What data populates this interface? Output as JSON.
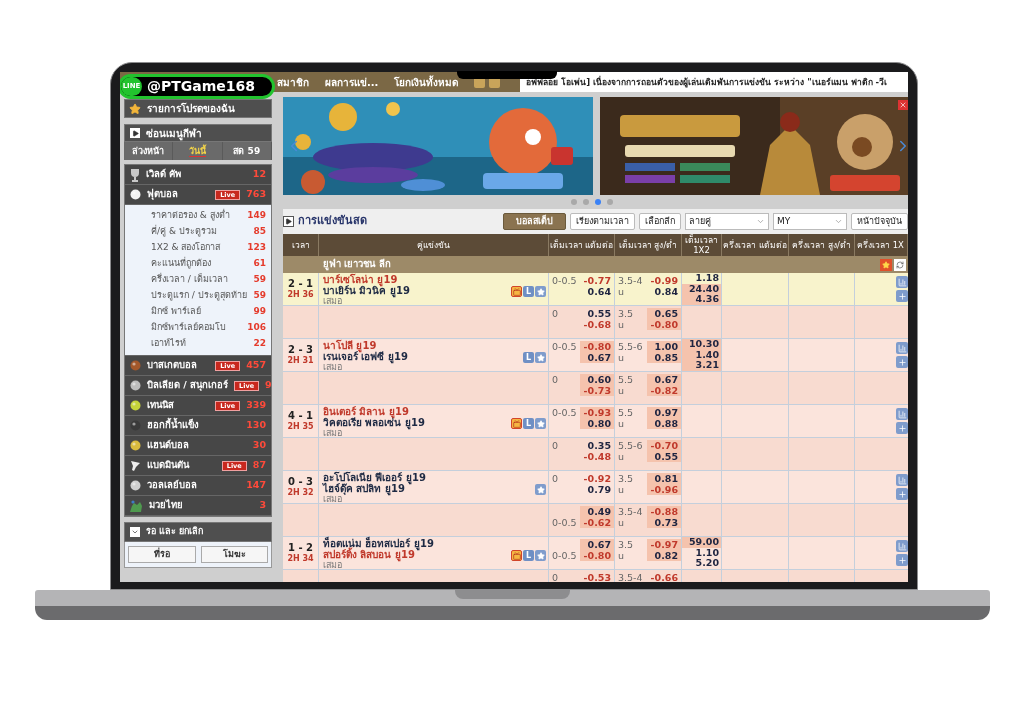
{
  "promo_badge": {
    "logo": "LINE",
    "handle": "@PTGame168"
  },
  "nav": {
    "items": [
      "สมาชิก",
      "ผลการแข่...",
      "โยกเงินทั้งหมด"
    ],
    "ticker": "อฟฟลอย โอเพ่น] เนื่องจากการถอนตัวของผู้เล่นเดิมพันการแข่งขัน ระหว่าง \"เนอร์แมน ฟาติก -วีเ"
  },
  "sidebar": {
    "favorites": "รายการโปรดของฉัน",
    "menu_toggle": "ซ่อนเมนูกีฬา",
    "tabs": [
      {
        "label": "ล่วงหน้า",
        "selected": false
      },
      {
        "label": "วันนี้",
        "selected": true
      },
      {
        "label": "สด 59",
        "selected": false
      }
    ],
    "sports": [
      {
        "name": "เวิลด์ คัพ",
        "count": "12",
        "kind": "trophy"
      },
      {
        "name": "ฟุตบอล",
        "count": "763",
        "kind": "soccer",
        "badge": "Live",
        "children": [
          {
            "name": "ราคาต่อรอง & สูงต่ำ",
            "count": "149"
          },
          {
            "name": "คี่/คู่ & ประตูรวม",
            "count": "85"
          },
          {
            "name": "1X2 & สองโอกาส",
            "count": "123"
          },
          {
            "name": "คะแนนที่ถูกต้อง",
            "count": "61"
          },
          {
            "name": "ครึ่งเวลา / เต็มเวลา",
            "count": "59"
          },
          {
            "name": "ประตูแรก / ประตูสุดท้าย",
            "count": "59"
          },
          {
            "name": "มิกซ์ พาร์เลย์",
            "count": "99"
          },
          {
            "name": "มิกซ์พาร์เลย์คอมโบ",
            "count": "106"
          },
          {
            "name": "เอาท์ไรท์",
            "count": "22"
          }
        ]
      },
      {
        "name": "บาสเกตบอล",
        "count": "457",
        "kind": "basketball",
        "badge": "Live"
      },
      {
        "name": "บิลเลียด / สนุกเกอร์",
        "count": "9",
        "kind": "billiards",
        "badge": "Live"
      },
      {
        "name": "เทนนิส",
        "count": "339",
        "kind": "tennis",
        "badge": "Live"
      },
      {
        "name": "ฮอกกี้น้ำแข็ง",
        "count": "130",
        "kind": "hockey"
      },
      {
        "name": "แฮนด์บอล",
        "count": "30",
        "kind": "handball"
      },
      {
        "name": "แบดมินตัน",
        "count": "87",
        "kind": "badminton",
        "badge": "Live"
      },
      {
        "name": "วอลเลย์บอล",
        "count": "147",
        "kind": "volleyball"
      },
      {
        "name": "มวยไทย",
        "count": "3",
        "kind": "boxing"
      }
    ],
    "pending": {
      "title": "รอ และ ยกเลิก",
      "buttons": [
        "ที่รอ",
        "โมฆะ"
      ]
    }
  },
  "carousel": {
    "dots": [
      {
        "selected": false
      },
      {
        "selected": false
      },
      {
        "selected": true
      },
      {
        "selected": false
      }
    ]
  },
  "live": {
    "title": "การแข่งขันสด",
    "controls": [
      {
        "kind": "button",
        "label": "บอลสเต็ป",
        "selected": true
      },
      {
        "kind": "button",
        "label": "เรียงตามเวลา",
        "selected": false
      },
      {
        "kind": "button",
        "label": "เลือกลีก",
        "selected": false
      },
      {
        "kind": "select",
        "label": "ลายคู่"
      },
      {
        "kind": "select",
        "label": "MY"
      },
      {
        "kind": "button",
        "label": "หน้าปัจจุบัน",
        "selected": false
      }
    ],
    "columns": [
      "เวลา",
      "คู่แข่งขัน",
      "เต็มเวลา แต้มต่อ",
      "เต็มเวลา สูง/ต่ำ",
      "เต็มเวลา 1X2",
      "ครึ่งเวลา แต้มต่อ",
      "ครึ่งเวลา สูง/ต่ำ",
      "ครึ่งเวลา 1X"
    ],
    "league": "ยูฟ่า เยาวชน ลีก",
    "matches": [
      {
        "score": "2 - 1",
        "time": "2H 36",
        "selected": true,
        "teams": [
          {
            "name": "บาร์เซโลน่า ยู19",
            "favorite": true
          },
          {
            "name": "บาเยิร์น มิวนิค ยู19",
            "favorite": false
          }
        ],
        "draw": "เสมอ",
        "icons": [
          {
            "kind": "tv"
          },
          {
            "kind": "letter",
            "text": "L"
          },
          {
            "kind": "star"
          }
        ],
        "lines": [
          {
            "handicap": {
              "line": "0-0.5",
              "away_gives": false,
              "highlight": false,
              "odds": [
                {
                  "text": "-0.77",
                  "negative": true
                },
                {
                  "text": "0.64",
                  "negative": false
                }
              ]
            },
            "over_under": {
              "line": "3.5-4",
              "under_label": "u",
              "highlight": false,
              "odds": [
                {
                  "text": "-0.99",
                  "negative": true
                },
                {
                  "text": "0.84",
                  "negative": false
                }
              ]
            },
            "result": [
              {
                "text": "1.18",
                "highlight": false
              },
              {
                "text": "24.40",
                "highlight": true
              },
              {
                "text": "4.36",
                "highlight": true
              }
            ]
          },
          {
            "handicap": {
              "line": "0",
              "away_gives": false,
              "highlight": false,
              "odds": [
                {
                  "text": "0.55",
                  "negative": false
                },
                {
                  "text": "-0.68",
                  "negative": true
                }
              ]
            },
            "over_under": {
              "line": "3.5",
              "under_label": "u",
              "highlight": true,
              "odds": [
                {
                  "text": "0.65",
                  "negative": false
                },
                {
                  "text": "-0.80",
                  "negative": true
                }
              ]
            }
          }
        ]
      },
      {
        "score": "2 - 3",
        "time": "2H 31",
        "selected": false,
        "teams": [
          {
            "name": "นาโปลี ยู19",
            "favorite": true
          },
          {
            "name": "เรนเจอร์ เอฟซี ยู19",
            "favorite": false
          }
        ],
        "draw": "เสมอ",
        "icons": [
          {
            "kind": "letter",
            "text": "L"
          },
          {
            "kind": "star"
          }
        ],
        "lines": [
          {
            "handicap": {
              "line": "0-0.5",
              "away_gives": false,
              "highlight": true,
              "odds": [
                {
                  "text": "-0.80",
                  "negative": true
                },
                {
                  "text": "0.67",
                  "negative": false
                }
              ]
            },
            "over_under": {
              "line": "5.5-6",
              "under_label": "u",
              "highlight": true,
              "odds": [
                {
                  "text": "1.00",
                  "negative": false
                },
                {
                  "text": "0.85",
                  "negative": false
                }
              ]
            },
            "result": [
              {
                "text": "10.30",
                "highlight": true
              },
              {
                "text": "1.40",
                "highlight": true
              },
              {
                "text": "3.21",
                "highlight": true
              }
            ]
          },
          {
            "handicap": {
              "line": "0",
              "away_gives": false,
              "highlight": true,
              "odds": [
                {
                  "text": "0.60",
                  "negative": false
                },
                {
                  "text": "-0.73",
                  "negative": true
                }
              ]
            },
            "over_under": {
              "line": "5.5",
              "under_label": "u",
              "highlight": true,
              "odds": [
                {
                  "text": "0.67",
                  "negative": false
                },
                {
                  "text": "-0.82",
                  "negative": true
                }
              ]
            }
          }
        ]
      },
      {
        "score": "4 - 1",
        "time": "2H 35",
        "selected": false,
        "teams": [
          {
            "name": "อินเตอร์ มิลาน ยู19",
            "favorite": true
          },
          {
            "name": "วิคตอเรีย พลอเซ่น ยู19",
            "favorite": false
          }
        ],
        "draw": "เสมอ",
        "icons": [
          {
            "kind": "tv"
          },
          {
            "kind": "letter",
            "text": "L"
          },
          {
            "kind": "star"
          }
        ],
        "lines": [
          {
            "handicap": {
              "line": "0-0.5",
              "away_gives": false,
              "highlight": true,
              "odds": [
                {
                  "text": "-0.93",
                  "negative": true
                },
                {
                  "text": "0.80",
                  "negative": false
                }
              ]
            },
            "over_under": {
              "line": "5.5",
              "under_label": "u",
              "highlight": true,
              "odds": [
                {
                  "text": "0.97",
                  "negative": false
                },
                {
                  "text": "0.88",
                  "negative": false
                }
              ]
            }
          },
          {
            "handicap": {
              "line": "0",
              "away_gives": false,
              "highlight": false,
              "odds": [
                {
                  "text": "0.35",
                  "negative": false
                },
                {
                  "text": "-0.48",
                  "negative": true
                }
              ]
            },
            "over_under": {
              "line": "5.5-6",
              "under_label": "u",
              "highlight": true,
              "odds": [
                {
                  "text": "-0.70",
                  "negative": true
                },
                {
                  "text": "0.55",
                  "negative": false
                }
              ]
            }
          }
        ]
      },
      {
        "score": "0 - 3",
        "time": "2H 32",
        "selected": false,
        "teams": [
          {
            "name": "อะโปโลเนีย ฟีเออร์ ยู19",
            "favorite": false
          },
          {
            "name": "ไฮจ์ดุ๊ค สปลิท ยู19",
            "favorite": false
          }
        ],
        "draw": "เสมอ",
        "icons": [
          {
            "kind": "star"
          }
        ],
        "lines": [
          {
            "handicap": {
              "line": "0",
              "away_gives": false,
              "highlight": false,
              "odds": [
                {
                  "text": "-0.92",
                  "negative": true
                },
                {
                  "text": "0.79",
                  "negative": false
                }
              ]
            },
            "over_under": {
              "line": "3.5",
              "under_label": "u",
              "highlight": true,
              "odds": [
                {
                  "text": "0.81",
                  "negative": false
                },
                {
                  "text": "-0.96",
                  "negative": true
                }
              ]
            }
          },
          {
            "handicap": {
              "line": "0-0.5",
              "away_gives": true,
              "highlight": true,
              "odds": [
                {
                  "text": "0.49",
                  "negative": false
                },
                {
                  "text": "-0.62",
                  "negative": true
                }
              ]
            },
            "over_under": {
              "line": "3.5-4",
              "under_label": "u",
              "highlight": true,
              "odds": [
                {
                  "text": "-0.88",
                  "negative": true
                },
                {
                  "text": "0.73",
                  "negative": false
                }
              ]
            }
          }
        ]
      },
      {
        "score": "1 - 2",
        "time": "2H 34",
        "selected": false,
        "teams": [
          {
            "name": "ท็อตแน่ม ฮ็อทสเปอร์ ยู19",
            "favorite": false
          },
          {
            "name": "สปอร์ติ้ง ลิสบอน ยู19",
            "favorite": true
          }
        ],
        "draw": "เสมอ",
        "icons": [
          {
            "kind": "tv"
          },
          {
            "kind": "letter",
            "text": "L"
          },
          {
            "kind": "star"
          }
        ],
        "lines": [
          {
            "handicap": {
              "line": "0-0.5",
              "away_gives": true,
              "highlight": true,
              "odds": [
                {
                  "text": "0.67",
                  "negative": false
                },
                {
                  "text": "-0.80",
                  "negative": true
                }
              ]
            },
            "over_under": {
              "line": "3.5",
              "under_label": "u",
              "highlight": true,
              "odds": [
                {
                  "text": "-0.97",
                  "negative": true
                },
                {
                  "text": "0.82",
                  "negative": false
                }
              ]
            },
            "result": [
              {
                "text": "59.00",
                "highlight": true
              },
              {
                "text": "1.10",
                "highlight": false
              },
              {
                "text": "5.20",
                "highlight": false
              }
            ]
          },
          {
            "handicap": {
              "line": "0",
              "away_gives": false,
              "highlight": false,
              "odds": [
                {
                  "text": "-0.53",
                  "negative": true
                }
              ]
            },
            "over_under": {
              "line": "3.5-4",
              "highlight": false,
              "odds": [
                {
                  "text": "-0.66",
                  "negative": true
                }
              ]
            }
          }
        ]
      }
    ]
  }
}
